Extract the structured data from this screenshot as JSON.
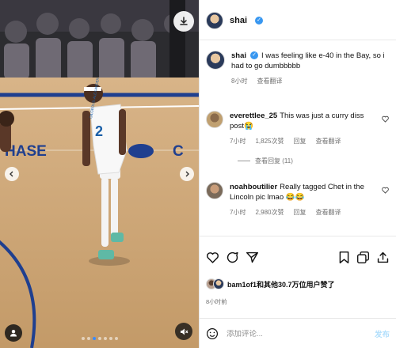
{
  "post": {
    "author": "shai",
    "caption": "I was feeling like e-40 in the Bay, so i had to go dumbbbbb",
    "caption_time": "8小时",
    "caption_translate": "查看翻译"
  },
  "photo": {
    "jersey_text": "GILGEOUS-ALEXANDER",
    "jersey_number": "2",
    "court_text": "HASE"
  },
  "comments": [
    {
      "user": "everettlee_25",
      "text": "This was just a curry diss post😭",
      "time": "7小时",
      "likes": "1,825次赞",
      "reply": "回复",
      "translate": "查看翻译",
      "view_replies": "查看回复 (11)"
    },
    {
      "user": "noahboutilier",
      "text": "Really tagged Chet in the Lincoln pic lmao 😂😂",
      "time": "7小时",
      "likes": "2,980次赞",
      "reply": "回复",
      "translate": "查看翻译"
    }
  ],
  "likes_summary": "bam1of1和其他30.7万位用户赞了",
  "post_time": "8小时前",
  "add_comment": {
    "placeholder": "添加评论...",
    "post_label": "发布"
  },
  "carousel": {
    "count": 7,
    "active": 2
  },
  "colors": {
    "verified": "#3897f0",
    "accent": "#0095f6",
    "court_blue": "#1f3f8f"
  }
}
